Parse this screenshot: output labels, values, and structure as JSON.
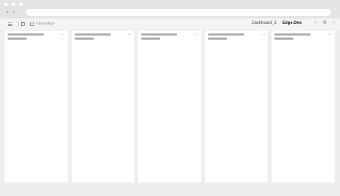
{
  "browser": {
    "nav_back": "‹",
    "nav_forward": "›",
    "address_value": ""
  },
  "toolbar": {
    "breadcrumb": "<\\fe\\ter\\fe2>",
    "dashboard_label": "Dashboard_3",
    "workspace_label": "Edge.One"
  },
  "icons": {
    "search": "⌕",
    "users": "⧉",
    "bell": "◔"
  },
  "columns": [
    {
      "menu": "···"
    },
    {
      "menu": "···"
    },
    {
      "menu": "···"
    },
    {
      "menu": "···"
    },
    {
      "menu": "···"
    }
  ]
}
